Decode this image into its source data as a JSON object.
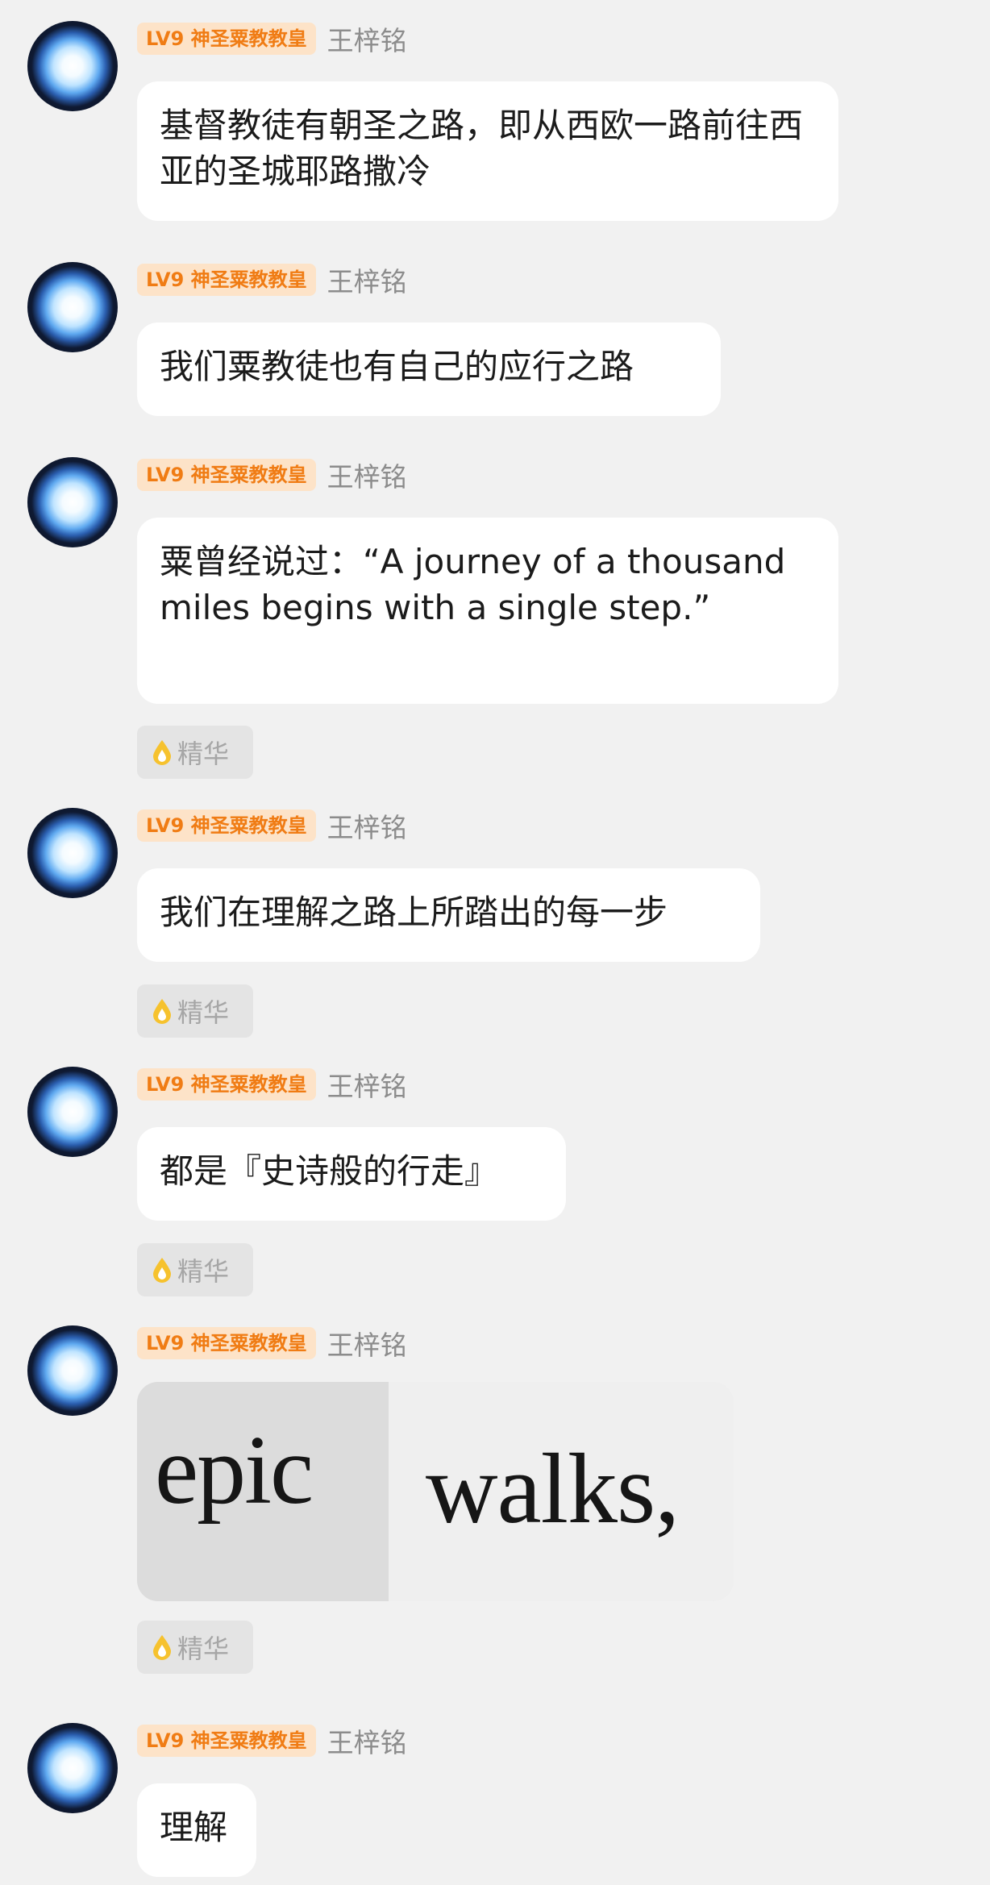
{
  "sender": {
    "badge": "LV9 神圣粟教教皇",
    "name": "王梓铭"
  },
  "tag_label": "精华",
  "messages": [
    {
      "text": "基督教徒有朝圣之路，即从西欧一路前往西亚的圣城耶路撒冷"
    },
    {
      "text": "我们粟教徒也有自己的应行之路"
    },
    {
      "text": "粟曾经说过：“A journey of a thousand miles begins with a single step.”"
    },
    {
      "text": "我们在理解之路上所踏出的每一步"
    },
    {
      "text": "都是『史诗般的行走』"
    },
    {
      "image_words": [
        "epic",
        "walks,"
      ]
    },
    {
      "text": "理解"
    }
  ],
  "colors": {
    "background": "#f1f1f1",
    "badge_bg": "#fde3c8",
    "badge_text": "#f07c14",
    "tag_bg": "#e4e4e4",
    "drop": "#f6c22e"
  }
}
